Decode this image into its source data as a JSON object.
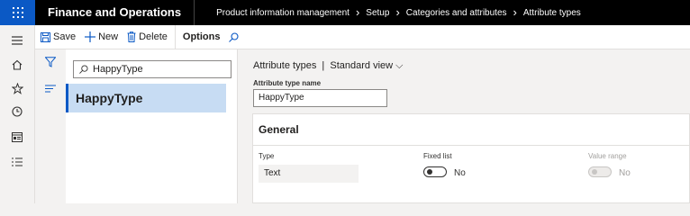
{
  "header": {
    "app_title": "Finance and Operations",
    "breadcrumb": [
      "Product information management",
      "Setup",
      "Categories and attributes",
      "Attribute types"
    ]
  },
  "leftnav": {
    "items": [
      "hamburger-icon",
      "home-icon",
      "star-icon",
      "clock-icon",
      "workspace-icon",
      "list-icon"
    ]
  },
  "toolbar": {
    "save_label": "Save",
    "new_label": "New",
    "delete_label": "Delete",
    "options_label": "Options"
  },
  "list": {
    "search_value": "HappyType",
    "items": [
      {
        "label": "HappyType",
        "selected": true
      }
    ]
  },
  "main": {
    "view_title": "Attribute types  |  Standard view",
    "name_label": "Attribute type name",
    "name_value": "HappyType",
    "general": {
      "title": "General",
      "type_label": "Type",
      "type_value": "Text",
      "fixed_list_label": "Fixed list",
      "fixed_list_value": "No",
      "value_range_label": "Value range",
      "value_range_value": "No"
    }
  },
  "colors": {
    "accent": "#0b59c5",
    "selected_bg": "#c7dcf3",
    "topbar": "#000000"
  }
}
